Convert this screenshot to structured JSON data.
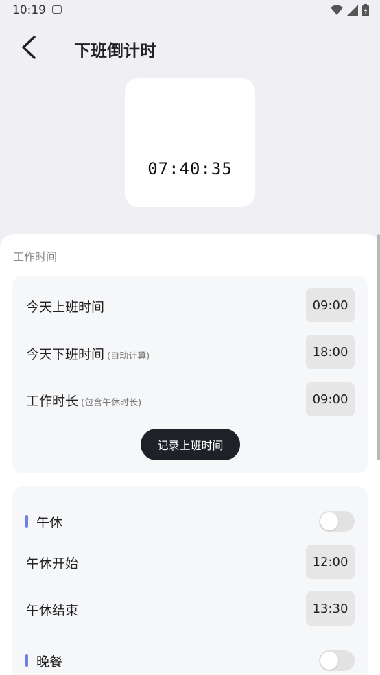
{
  "status_bar": {
    "time": "10:19",
    "icons": [
      "notification-icon",
      "wifi-icon",
      "signal-icon",
      "battery-icon"
    ]
  },
  "app_bar": {
    "title": "下班倒计时",
    "back_icon": "chevron-left-icon"
  },
  "mascot": {
    "countdown": "07:40:35"
  },
  "work_section": {
    "label": "工作时间",
    "rows": [
      {
        "label": "今天上班时间",
        "hint": "",
        "value": "09:00"
      },
      {
        "label": "今天下班时间",
        "hint": "(自动计算)",
        "value": "18:00"
      },
      {
        "label": "工作时长",
        "hint": "(包含午休时长)",
        "value": "09:00"
      }
    ],
    "record_button": "记录上班时间"
  },
  "break_section": {
    "lunch": {
      "title": "午休",
      "enabled": false,
      "start_label": "午休开始",
      "start_value": "12:00",
      "end_label": "午休结束",
      "end_value": "13:30"
    },
    "dinner": {
      "title": "晚餐",
      "enabled": false
    }
  },
  "colors": {
    "background": "#efeff4",
    "card": "#f6f7f9",
    "accent": "#6f80e0",
    "button": "#1e2228"
  }
}
